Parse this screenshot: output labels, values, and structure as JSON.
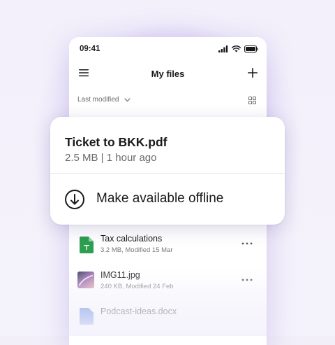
{
  "status_bar": {
    "time": "09:41",
    "icons": [
      "signal-icon",
      "wifi-icon",
      "battery-icon"
    ]
  },
  "header": {
    "title": "My files",
    "menu_icon": "menu-icon",
    "add_icon": "plus-icon"
  },
  "sort": {
    "label": "Last modified",
    "chevron_icon": "chevron-down-icon",
    "view_icon": "grid-view-icon"
  },
  "files": [
    {
      "name": "Tax calculations",
      "meta": "3.2 MB, Modified 15 Mar",
      "icon": "spreadsheet-icon"
    },
    {
      "name": "IMG11.jpg",
      "meta": "240 KB, Modified 24 Feb",
      "icon": "image-thumbnail"
    },
    {
      "name": "Podcast-ideas.docx",
      "meta": "",
      "icon": "document-icon"
    }
  ],
  "popup": {
    "file_name": "Ticket to BKK.pdf",
    "file_info": "2.5 MB | 1 hour ago",
    "action_label": "Make available offline",
    "action_icon": "download-circle-icon"
  },
  "colors": {
    "accent_purple": "#9a7ee6",
    "spreadsheet_green": "#2e9e4f",
    "text_primary": "#1a1a1a",
    "text_secondary": "#6b6b6b"
  }
}
